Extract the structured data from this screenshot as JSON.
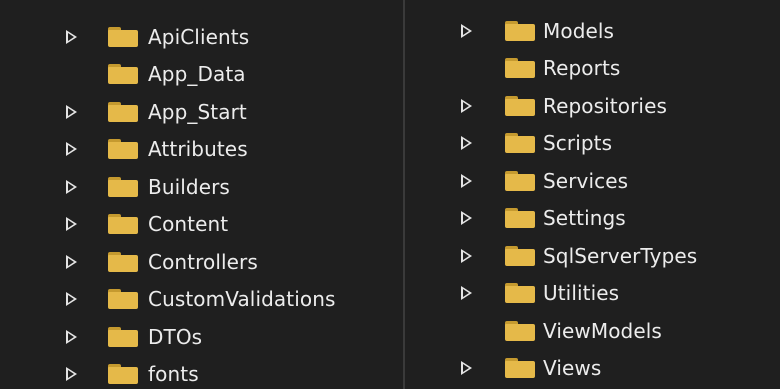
{
  "explorer": {
    "left_items": [
      {
        "label": "ApiClients",
        "expandable": true
      },
      {
        "label": "App_Data",
        "expandable": false
      },
      {
        "label": "App_Start",
        "expandable": true
      },
      {
        "label": "Attributes",
        "expandable": true
      },
      {
        "label": "Builders",
        "expandable": true
      },
      {
        "label": "Content",
        "expandable": true
      },
      {
        "label": "Controllers",
        "expandable": true
      },
      {
        "label": "CustomValidations",
        "expandable": true
      },
      {
        "label": "DTOs",
        "expandable": true
      },
      {
        "label": "fonts",
        "expandable": true
      }
    ],
    "right_items": [
      {
        "label": "Models",
        "expandable": true
      },
      {
        "label": "Reports",
        "expandable": false
      },
      {
        "label": "Repositories",
        "expandable": true
      },
      {
        "label": "Scripts",
        "expandable": true
      },
      {
        "label": "Services",
        "expandable": true
      },
      {
        "label": "Settings",
        "expandable": true
      },
      {
        "label": "SqlServerTypes",
        "expandable": true
      },
      {
        "label": "Utilities",
        "expandable": true
      },
      {
        "label": "ViewModels",
        "expandable": false
      },
      {
        "label": "Views",
        "expandable": true
      }
    ]
  },
  "colors": {
    "background": "#1f1f1f",
    "folder": "#e5b949",
    "folder_tab": "#c59a2f",
    "text": "#ececec",
    "arrow": "#e4e4e4"
  },
  "icons": {
    "expander": "chevron-right-outline-icon",
    "item": "folder-icon"
  }
}
